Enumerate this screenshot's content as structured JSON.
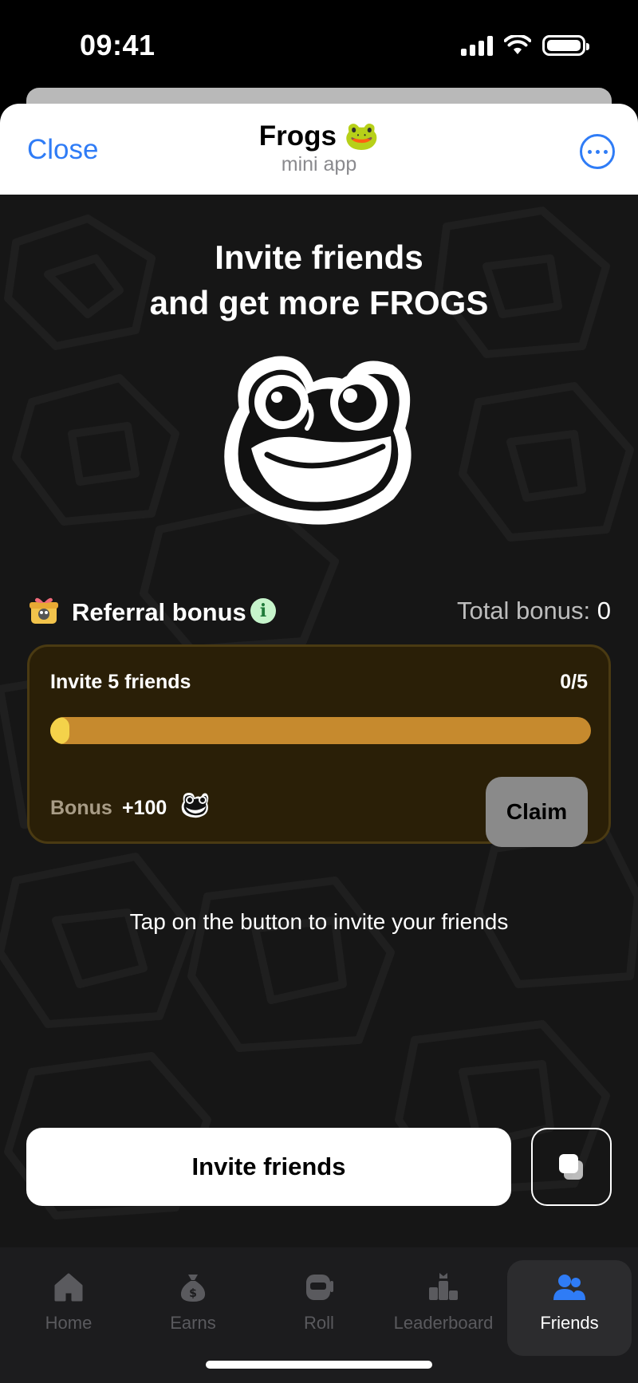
{
  "status_bar": {
    "time": "09:41"
  },
  "header": {
    "close_label": "Close",
    "title": "Frogs 🐸",
    "subtitle": "mini app",
    "more_icon": "ellipsis-icon"
  },
  "main": {
    "headline_line1": "Invite friends",
    "headline_line2": "and get more FROGS",
    "referral": {
      "title": "Referral bonus",
      "info_glyph": "i",
      "total_label": "Total bonus:",
      "total_value": "0"
    },
    "task": {
      "title": "Invite 5 friends",
      "count": "0/5",
      "progress_fraction": 0,
      "bonus_label": "Bonus",
      "bonus_value": "+100",
      "claim_label": "Claim"
    },
    "hint": "Tap on the button to invite your friends",
    "invite_button_label": "Invite friends",
    "copy_icon": "copy-icon"
  },
  "tabbar": {
    "tabs": [
      {
        "label": "Home",
        "icon": "home-icon"
      },
      {
        "label": "Earns",
        "icon": "money-bag-icon"
      },
      {
        "label": "Roll",
        "icon": "roll-icon"
      },
      {
        "label": "Leaderboard",
        "icon": "leaderboard-icon"
      },
      {
        "label": "Friends",
        "icon": "friends-icon",
        "active": true
      }
    ]
  },
  "colors": {
    "accent_blue": "#2f7cf6",
    "progress_track": "#c68a2e",
    "progress_fill": "#f4d24a",
    "card_bg": "#2a1f07"
  }
}
